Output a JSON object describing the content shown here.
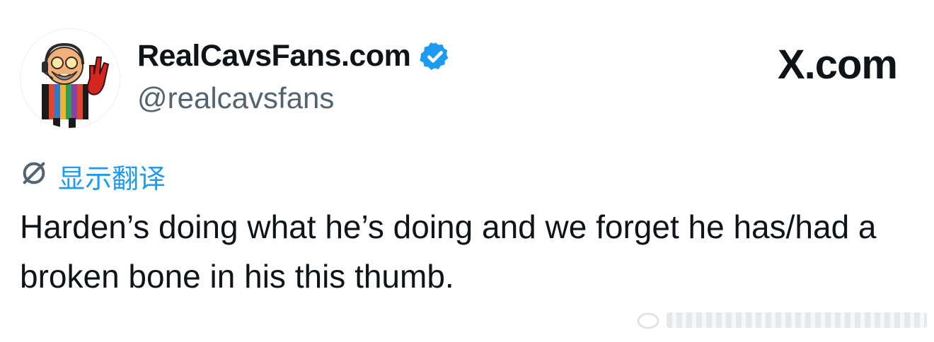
{
  "tweet": {
    "display_name": "RealCavsFans.com",
    "handle": "@realcavsfans",
    "verified_icon": "verified-badge-icon",
    "brand_logo": "X.com",
    "translate_label": "显示翻译",
    "translate_icon": "translate-icon",
    "text": "Harden’s doing what he’s doing and we forget he has/had a broken bone in his this thumb."
  },
  "colors": {
    "accent": "#1d9bf0",
    "text": "#0f1419",
    "secondary_text": "#536471"
  }
}
